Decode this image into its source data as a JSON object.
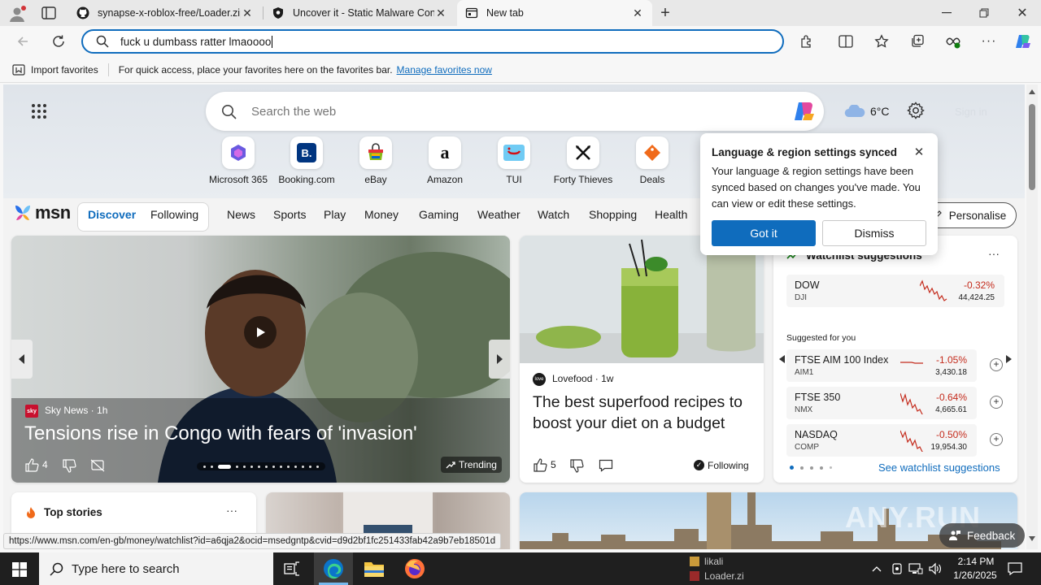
{
  "browser": {
    "tabs": [
      {
        "title": "synapse-x-roblox-free/Loader.zip",
        "icon": "github-icon"
      },
      {
        "title": "Uncover it - Static Malware Config",
        "icon": "malware-site-icon"
      },
      {
        "title": "New tab",
        "icon": "newtab-icon"
      }
    ],
    "address_value": "fuck u dumbass ratter lmaoooo"
  },
  "favorites_bar": {
    "import_label": "Import favorites",
    "hint": "For quick access, place your favorites here on the favorites bar.",
    "manage_link": "Manage favorites now"
  },
  "newtab": {
    "search_placeholder": "Search the web",
    "weather_temp": "6°C",
    "signin_label": "Sign in",
    "shortcuts": [
      {
        "label": "Microsoft 365",
        "icon": "microsoft365-icon"
      },
      {
        "label": "Booking.com",
        "icon": "booking-icon"
      },
      {
        "label": "eBay",
        "icon": "ebay-icon"
      },
      {
        "label": "Amazon",
        "icon": "amazon-icon"
      },
      {
        "label": "TUI",
        "icon": "tui-icon"
      },
      {
        "label": "Forty Thieves",
        "icon": "forty-thieves-icon"
      },
      {
        "label": "Deals",
        "icon": "deals-icon"
      }
    ],
    "msn_logo": "msn",
    "feed_tabs": [
      "Discover",
      "Following"
    ],
    "categories": [
      "News",
      "Sports",
      "Play",
      "Money",
      "Gaming",
      "Weather",
      "Watch",
      "Shopping",
      "Health"
    ],
    "personalise_label": "Personalise"
  },
  "popup": {
    "title": "Language & region settings synced",
    "body": "Your language & region settings have been synced based on changes you've made. You can view or edit these settings.",
    "primary": "Got it",
    "secondary": "Dismiss"
  },
  "hero": {
    "source": "Sky News",
    "age": "1h",
    "headline": "Tensions rise in Congo with fears of 'invasion'",
    "likes": "4",
    "trending": "Trending"
  },
  "food_card": {
    "source": "Lovefood",
    "age": "1w",
    "headline": "The best superfood recipes to boost your diet on a budget",
    "likes": "5",
    "following": "Following"
  },
  "watchlist": {
    "title": "Watchlist suggestions",
    "top": {
      "name": "DOW",
      "sym": "DJI",
      "change": "-0.32%",
      "price": "44,424.25"
    },
    "suggested_label": "Suggested for you",
    "rows": [
      {
        "name": "FTSE AIM 100 Index",
        "sym": "AIM1",
        "change": "-1.05%",
        "price": "3,430.18"
      },
      {
        "name": "FTSE 350",
        "sym": "NMX",
        "change": "-0.64%",
        "price": "4,665.61"
      },
      {
        "name": "NASDAQ",
        "sym": "COMP",
        "change": "-0.50%",
        "price": "19,954.30"
      }
    ],
    "see_link": "See watchlist suggestions"
  },
  "top_stories": {
    "title": "Top stories"
  },
  "feedback_label": "Feedback",
  "watermark": "ANY.RUN",
  "status_url": "https://www.msn.com/en-gb/money/watchlist?id=a6qja2&ocid=msedgntp&cvid=d9d2bf1fc251433fab42a9b7eb18501d",
  "taskbar": {
    "search_placeholder": "Type here to search",
    "time": "2:14 PM",
    "date": "1/26/2025",
    "desktop_items": [
      "likali",
      "Loader.zi"
    ]
  }
}
